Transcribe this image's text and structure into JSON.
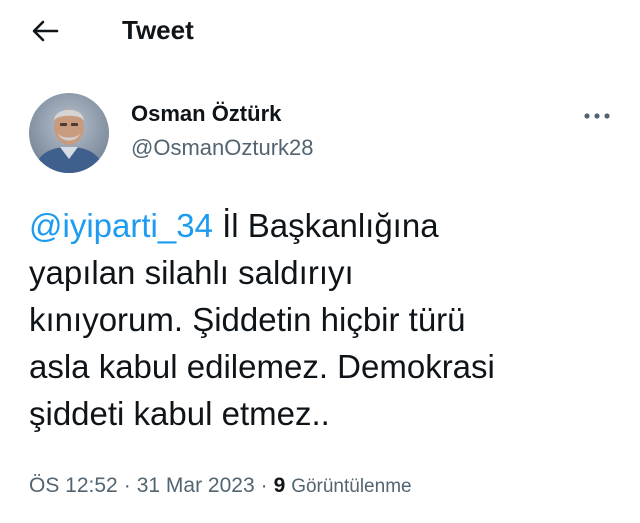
{
  "header": {
    "title": "Tweet",
    "back_icon": "arrow-left-icon"
  },
  "tweet": {
    "author": {
      "name": "Osman Öztürk",
      "handle": "@OsmanOzturk28",
      "avatar_icon": "profile-photo"
    },
    "more_icon": "more-horizontal-icon",
    "text": {
      "mention": "@iyiparti_34",
      "line1_rest": " İl Başkanlığına",
      "line2": "yapılan silahlı saldırıyı",
      "line3": "kınıyorum. Şiddetin hiçbir türü",
      "line4": "asla kabul edilemez. Demokrasi",
      "line5": "şiddeti kabul etmez.."
    },
    "meta": {
      "time": "ÖS 12:52",
      "separator": "·",
      "date": "31 Mar 2023",
      "views_count": "9",
      "views_label": "Görüntülenme"
    }
  },
  "colors": {
    "text": "#0f1419",
    "secondary": "#536471",
    "link": "#1d9bf0",
    "background": "#ffffff"
  }
}
